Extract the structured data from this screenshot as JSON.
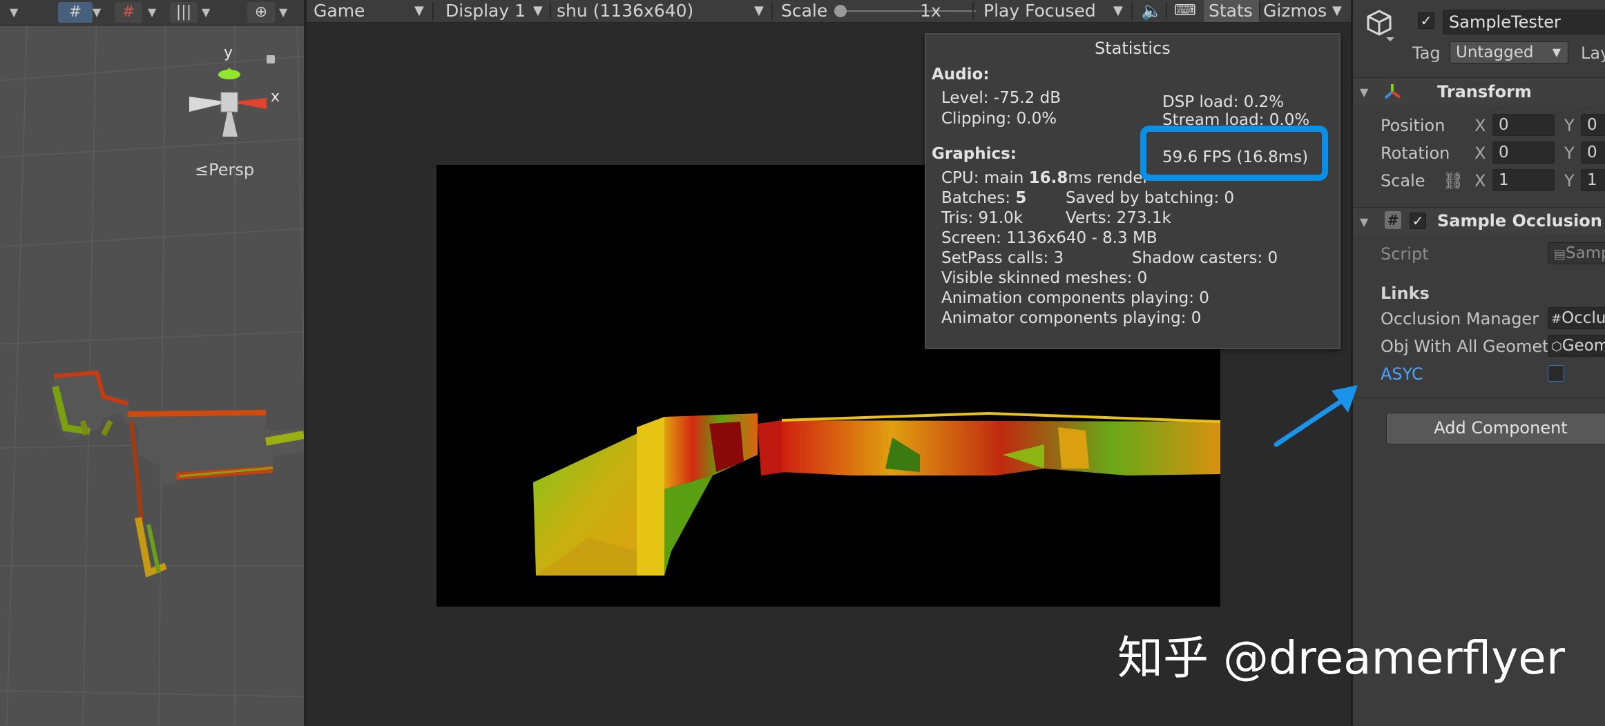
{
  "scene_view": {
    "gizmo_axes": {
      "y": "y",
      "x": "x"
    },
    "persp_label": "≤Persp",
    "toolbar_icons": [
      "grid-snap-icon",
      "grid-icon",
      "ruler-icon",
      "gizmo-globe-icon"
    ]
  },
  "game_toolbar": {
    "view_label": "Game",
    "display_label": "Display 1",
    "resolution_label": "shu (1136x640)",
    "scale_label": "Scale",
    "scale_value": "1x",
    "scale_level": 0,
    "play_mode_label": "Play Focused",
    "stats_label": "Stats",
    "gizmos_label": "Gizmos"
  },
  "statistics": {
    "title": "Statistics",
    "audio_heading": "Audio:",
    "audio_level": "Level: -75.2 dB",
    "audio_clipping": "Clipping: 0.0%",
    "dsp_load": "DSP load: 0.2%",
    "stream_load": "Stream load: 0.0%",
    "graphics_heading": "Graphics:",
    "fps": "59.6 FPS (16.8ms)",
    "cpu_prefix": "CPU: main ",
    "cpu_main": "16.8",
    "cpu_suffix": "ms  render",
    "batches_prefix": "Batches: ",
    "batches_value": "5",
    "saved_by_batching": "Saved by batching: 0",
    "tris": "Tris: 91.0k",
    "verts": "Verts: 273.1k",
    "screen": "Screen: 1136x640 - 8.3 MB",
    "setpass": "SetPass calls: 3",
    "shadow_casters": "Shadow casters: 0",
    "skinned_meshes": "Visible skinned meshes: 0",
    "animation_components": "Animation components playing: 0",
    "animator_components": "Animator components playing: 0"
  },
  "inspector": {
    "object_name": "SampleTester",
    "active": true,
    "tag_label": "Tag",
    "tag_value": "Untagged",
    "layer_label": "Lay",
    "transform": {
      "title": "Transform",
      "position_label": "Position",
      "rotation_label": "Rotation",
      "scale_label": "Scale",
      "x_label": "X",
      "y_label": "Y",
      "position_x": "0",
      "position_y": "0",
      "rotation_x": "0",
      "rotation_y": "0",
      "scale_x": "1",
      "scale_y": "1"
    },
    "component": {
      "title": "Sample Occlusion Per",
      "enabled": true,
      "script_label": "Script",
      "script_value": "Samp",
      "links_heading": "Links",
      "occlusion_manager_label": "Occlusion Manager",
      "occlusion_manager_value": "Occlu",
      "obj_geometry_label": "Obj With All Geometry",
      "obj_geometry_value": "Geom",
      "async_label": "ASYC",
      "async_checked": false
    },
    "add_component_label": "Add Component"
  },
  "watermark": "知乎 @dreamerflyer",
  "colors": {
    "highlight_box": "#0a8fe8",
    "arrow": "#1a93ea",
    "link_label": "#4ea3ff"
  }
}
